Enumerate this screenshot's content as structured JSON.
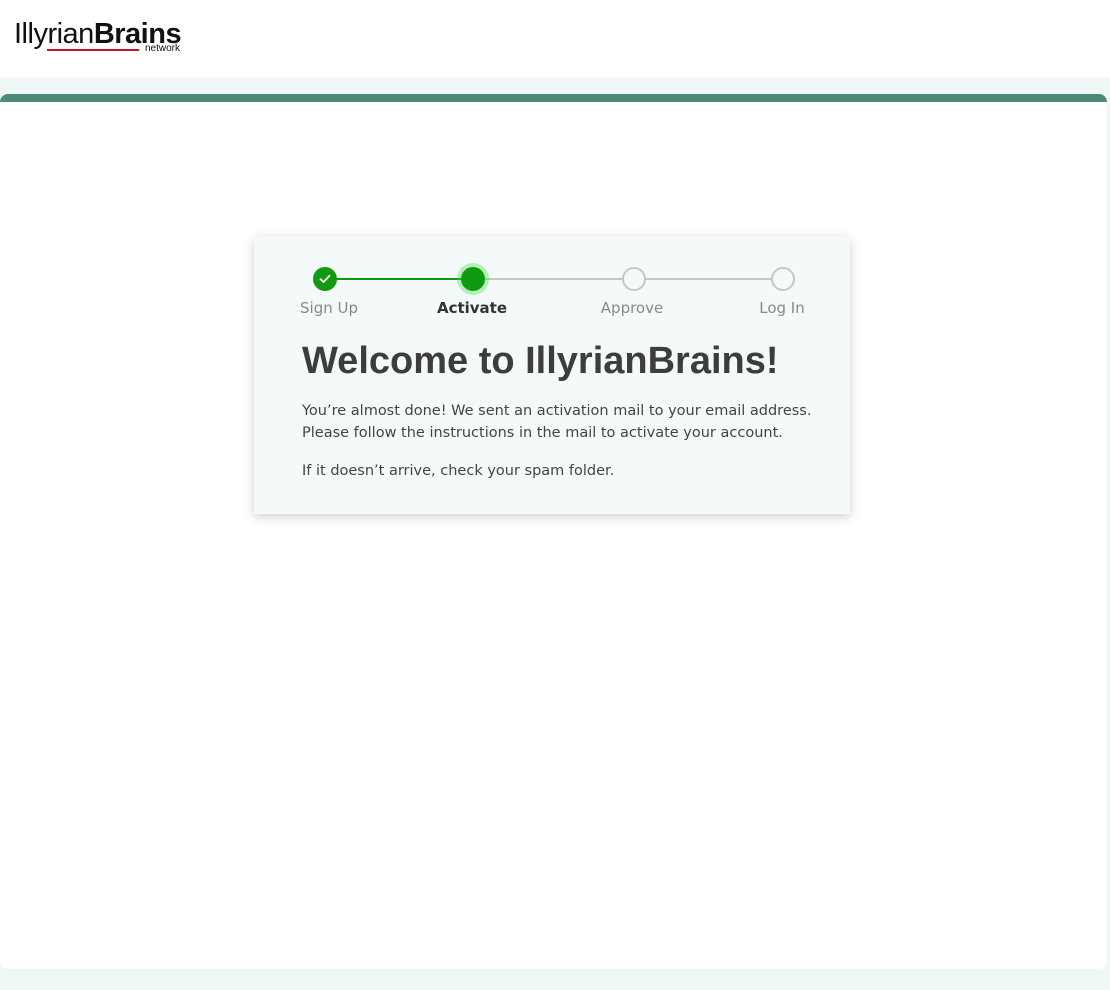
{
  "brand": {
    "logo_light": "Illyrian",
    "logo_bold": "Brains",
    "logo_sub": "network",
    "underline_color": "#c8102e"
  },
  "colors": {
    "accent": "#4e8a7a",
    "step_done": "#0f9a0f",
    "step_todo": "#c7c7c7"
  },
  "stepper": {
    "steps": [
      {
        "label": "Sign Up",
        "state": "done",
        "icon": "check-icon"
      },
      {
        "label": "Activate",
        "state": "active"
      },
      {
        "label": "Approve",
        "state": "todo"
      },
      {
        "label": "Log In",
        "state": "todo"
      }
    ]
  },
  "content": {
    "title": "Welcome to IllyrianBrains!",
    "paragraph1": "You’re almost done! We sent an activation mail to your email address. Please follow the instructions in the mail to activate your account.",
    "paragraph2": "If it doesn’t arrive, check your spam folder."
  }
}
